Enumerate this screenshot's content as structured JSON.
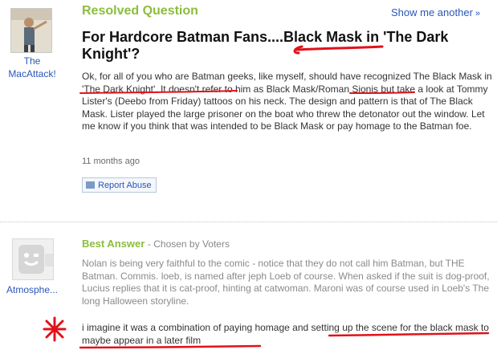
{
  "question": {
    "asker_name": "The MacAttack!",
    "status": "Resolved Question",
    "show_another": "Show me another",
    "title": "For Hardcore Batman Fans....Black Mask in 'The Dark Knight'?",
    "body": "Ok, for all of you who are Batman geeks, like myself, should have recognized The Black Mask in 'The Dark Knight'. It doesn't refer to him as Black Mask/Roman Sionis but take a look at Tommy Lister's (Deebo from Friday) tattoos on his neck. The design and pattern is that of The Black Mask. Lister played the large prisoner on the boat who threw the detonator out the window. Let me know if you think that was intended to be Black Mask or pay homage to the Batman foe.",
    "time": "11 months ago",
    "report_abuse": "Report Abuse"
  },
  "answer": {
    "answerer_name": "Atmosphe...",
    "label": "Best Answer",
    "chosen_by": "- Chosen by Voters",
    "body": "Nolan is being very faithful to the comic - notice that they do not call him Batman, but THE Batman. Commis. loeb, is named after jeph Loeb of course. When asked if the suit is dog-proof, Lucius replies that it is cat-proof, hinting at catwoman. Maroni was of course used in Loeb's The long Halloween storyline.",
    "extra": "i imagine it was a combination of paying homage and setting up the scene for the black mask to maybe appear in a later film"
  },
  "colors": {
    "link": "#2a56b8",
    "accent_green": "#8cbd3c",
    "annotation_red": "#e0121b"
  },
  "icons": {
    "show_another_chevron": "»",
    "report_flag": "flag-icon",
    "annotation_star": "asterisk"
  }
}
